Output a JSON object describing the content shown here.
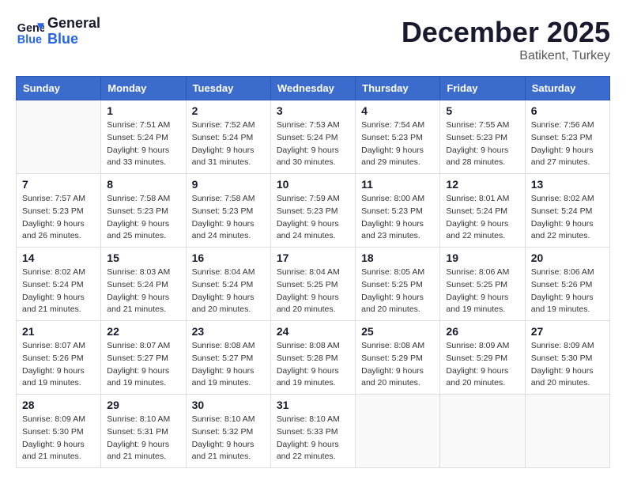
{
  "header": {
    "logo_line1": "General",
    "logo_line2": "Blue",
    "month": "December 2025",
    "location": "Batikent, Turkey"
  },
  "weekdays": [
    "Sunday",
    "Monday",
    "Tuesday",
    "Wednesday",
    "Thursday",
    "Friday",
    "Saturday"
  ],
  "weeks": [
    [
      {
        "day": "",
        "info": ""
      },
      {
        "day": "1",
        "info": "Sunrise: 7:51 AM\nSunset: 5:24 PM\nDaylight: 9 hours\nand 33 minutes."
      },
      {
        "day": "2",
        "info": "Sunrise: 7:52 AM\nSunset: 5:24 PM\nDaylight: 9 hours\nand 31 minutes."
      },
      {
        "day": "3",
        "info": "Sunrise: 7:53 AM\nSunset: 5:24 PM\nDaylight: 9 hours\nand 30 minutes."
      },
      {
        "day": "4",
        "info": "Sunrise: 7:54 AM\nSunset: 5:23 PM\nDaylight: 9 hours\nand 29 minutes."
      },
      {
        "day": "5",
        "info": "Sunrise: 7:55 AM\nSunset: 5:23 PM\nDaylight: 9 hours\nand 28 minutes."
      },
      {
        "day": "6",
        "info": "Sunrise: 7:56 AM\nSunset: 5:23 PM\nDaylight: 9 hours\nand 27 minutes."
      }
    ],
    [
      {
        "day": "7",
        "info": "Sunrise: 7:57 AM\nSunset: 5:23 PM\nDaylight: 9 hours\nand 26 minutes."
      },
      {
        "day": "8",
        "info": "Sunrise: 7:58 AM\nSunset: 5:23 PM\nDaylight: 9 hours\nand 25 minutes."
      },
      {
        "day": "9",
        "info": "Sunrise: 7:58 AM\nSunset: 5:23 PM\nDaylight: 9 hours\nand 24 minutes."
      },
      {
        "day": "10",
        "info": "Sunrise: 7:59 AM\nSunset: 5:23 PM\nDaylight: 9 hours\nand 24 minutes."
      },
      {
        "day": "11",
        "info": "Sunrise: 8:00 AM\nSunset: 5:23 PM\nDaylight: 9 hours\nand 23 minutes."
      },
      {
        "day": "12",
        "info": "Sunrise: 8:01 AM\nSunset: 5:24 PM\nDaylight: 9 hours\nand 22 minutes."
      },
      {
        "day": "13",
        "info": "Sunrise: 8:02 AM\nSunset: 5:24 PM\nDaylight: 9 hours\nand 22 minutes."
      }
    ],
    [
      {
        "day": "14",
        "info": "Sunrise: 8:02 AM\nSunset: 5:24 PM\nDaylight: 9 hours\nand 21 minutes."
      },
      {
        "day": "15",
        "info": "Sunrise: 8:03 AM\nSunset: 5:24 PM\nDaylight: 9 hours\nand 21 minutes."
      },
      {
        "day": "16",
        "info": "Sunrise: 8:04 AM\nSunset: 5:24 PM\nDaylight: 9 hours\nand 20 minutes."
      },
      {
        "day": "17",
        "info": "Sunrise: 8:04 AM\nSunset: 5:25 PM\nDaylight: 9 hours\nand 20 minutes."
      },
      {
        "day": "18",
        "info": "Sunrise: 8:05 AM\nSunset: 5:25 PM\nDaylight: 9 hours\nand 20 minutes."
      },
      {
        "day": "19",
        "info": "Sunrise: 8:06 AM\nSunset: 5:25 PM\nDaylight: 9 hours\nand 19 minutes."
      },
      {
        "day": "20",
        "info": "Sunrise: 8:06 AM\nSunset: 5:26 PM\nDaylight: 9 hours\nand 19 minutes."
      }
    ],
    [
      {
        "day": "21",
        "info": "Sunrise: 8:07 AM\nSunset: 5:26 PM\nDaylight: 9 hours\nand 19 minutes."
      },
      {
        "day": "22",
        "info": "Sunrise: 8:07 AM\nSunset: 5:27 PM\nDaylight: 9 hours\nand 19 minutes."
      },
      {
        "day": "23",
        "info": "Sunrise: 8:08 AM\nSunset: 5:27 PM\nDaylight: 9 hours\nand 19 minutes."
      },
      {
        "day": "24",
        "info": "Sunrise: 8:08 AM\nSunset: 5:28 PM\nDaylight: 9 hours\nand 19 minutes."
      },
      {
        "day": "25",
        "info": "Sunrise: 8:08 AM\nSunset: 5:29 PM\nDaylight: 9 hours\nand 20 minutes."
      },
      {
        "day": "26",
        "info": "Sunrise: 8:09 AM\nSunset: 5:29 PM\nDaylight: 9 hours\nand 20 minutes."
      },
      {
        "day": "27",
        "info": "Sunrise: 8:09 AM\nSunset: 5:30 PM\nDaylight: 9 hours\nand 20 minutes."
      }
    ],
    [
      {
        "day": "28",
        "info": "Sunrise: 8:09 AM\nSunset: 5:30 PM\nDaylight: 9 hours\nand 21 minutes."
      },
      {
        "day": "29",
        "info": "Sunrise: 8:10 AM\nSunset: 5:31 PM\nDaylight: 9 hours\nand 21 minutes."
      },
      {
        "day": "30",
        "info": "Sunrise: 8:10 AM\nSunset: 5:32 PM\nDaylight: 9 hours\nand 21 minutes."
      },
      {
        "day": "31",
        "info": "Sunrise: 8:10 AM\nSunset: 5:33 PM\nDaylight: 9 hours\nand 22 minutes."
      },
      {
        "day": "",
        "info": ""
      },
      {
        "day": "",
        "info": ""
      },
      {
        "day": "",
        "info": ""
      }
    ]
  ]
}
